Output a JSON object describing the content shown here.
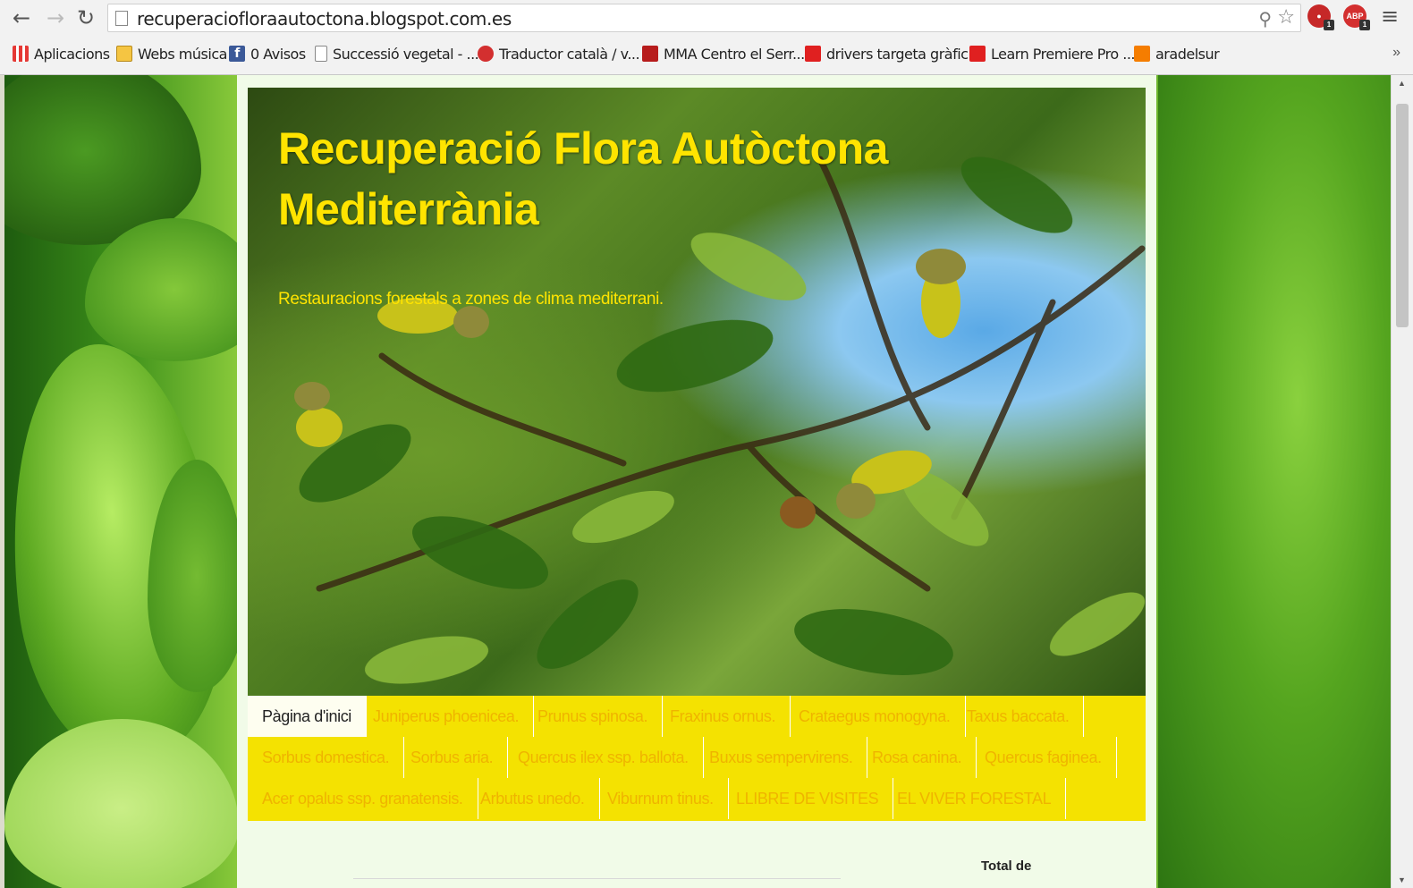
{
  "browser": {
    "url": "recuperaciofloraautoctona.blogspot.com.es",
    "bookmarks": [
      {
        "label": "Aplicacions",
        "icon": "apps-icon"
      },
      {
        "label": "Webs música",
        "icon": "folder-icon"
      },
      {
        "label": "0 Avisos",
        "icon": "facebook-icon"
      },
      {
        "label": "Successió vegetal - ...",
        "icon": "page-icon"
      },
      {
        "label": "Traductor català / v...",
        "icon": "sd-icon"
      },
      {
        "label": "MMA Centro el Serr...",
        "icon": "mma-icon"
      },
      {
        "label": "drivers targeta gràfic...",
        "icon": "adobe-icon"
      },
      {
        "label": "Learn Premiere Pro ...",
        "icon": "adobe-icon"
      },
      {
        "label": "aradelsur",
        "icon": "blogger-icon"
      }
    ],
    "more_bookmarks": "»",
    "extensions": [
      {
        "name": "extension-red-icon",
        "badge": "1"
      },
      {
        "name": "adblock-plus-icon",
        "label": "ABP",
        "badge": "1"
      }
    ]
  },
  "blog": {
    "title_line1": "Recuperació Flora Autòctona",
    "title_line2": "Mediterrània",
    "description": "Restauracions forestals a zones de clima mediterrani.",
    "tabs_row1": [
      "Pàgina d'inici",
      "Juniperus phoenicea.",
      "Prunus spinosa.",
      "Fraxinus ornus.",
      "Crataegus monogyna.",
      "Taxus baccata."
    ],
    "tabs_row2": [
      "Sorbus domestica.",
      "Sorbus aria.",
      "Quercus ilex ssp. ballota.",
      "Buxus sempervirens.",
      "Rosa canina.",
      "Quercus faginea."
    ],
    "tabs_row3": [
      "Acer opalus ssp. granatensis.",
      "Arbutus unedo.",
      "Viburnum tinus.",
      "LLIBRE DE VISITES",
      "EL VIVER FORESTAL"
    ],
    "active_tab": "Pàgina d'inici",
    "sidebar_heading": "Total de"
  },
  "colors": {
    "tab_bar": "#f4e201",
    "tab_text": "#efb400",
    "title": "#ffe400",
    "page_bg": "#f1fbe8"
  }
}
